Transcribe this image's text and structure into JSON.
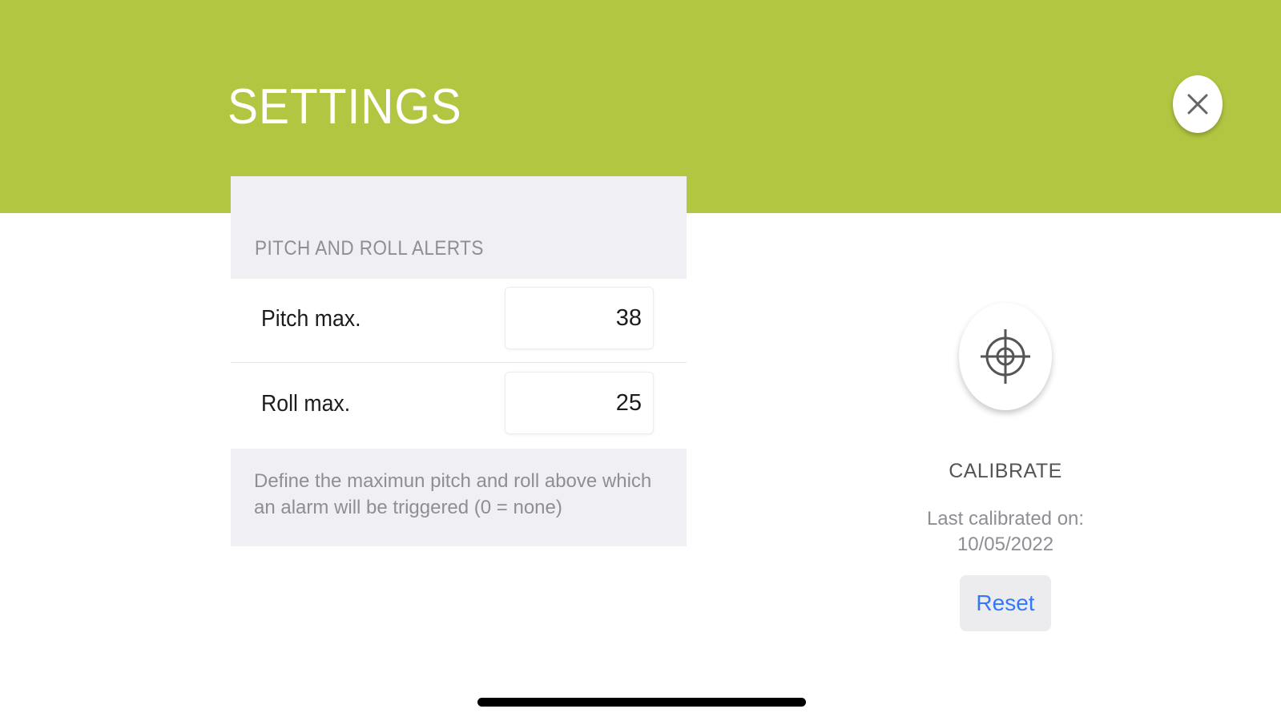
{
  "header": {
    "title": "SETTINGS",
    "close_icon": "close-icon",
    "background_color": "#b3c641"
  },
  "alerts": {
    "section_title": "PITCH AND ROLL ALERTS",
    "rows": [
      {
        "label": "Pitch max.",
        "value": "38"
      },
      {
        "label": "Roll max.",
        "value": "25"
      }
    ],
    "footer": "Define the maximun pitch and roll above which an alarm will be triggered (0 = none)"
  },
  "calibration": {
    "icon": "crosshair-icon",
    "label": "CALIBRATE",
    "last_calibrated_label": "Last calibrated on:",
    "last_calibrated_date": "10/05/2022",
    "reset_label": "Reset"
  },
  "colors": {
    "accent": "#b3c641",
    "link": "#3478f6",
    "grouped_background": "#efeff4"
  }
}
